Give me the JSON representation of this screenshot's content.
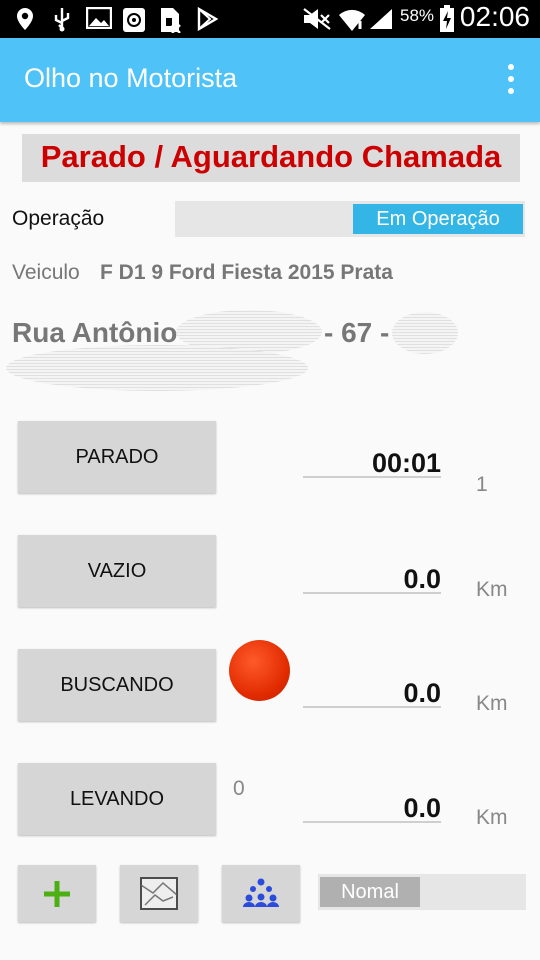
{
  "status_bar": {
    "battery_percent": "58%",
    "time": "02:06",
    "icons": [
      "location-pin-icon",
      "usb-icon",
      "image-icon",
      "accessibility-icon",
      "sim-card-icon",
      "play-store-icon",
      "mute-icon",
      "wifi-icon",
      "signal-icon",
      "battery-charging-icon"
    ]
  },
  "action_bar": {
    "title": "Olho no Motorista",
    "menu_icon": "overflow-menu-icon",
    "color": "#4fc3f7"
  },
  "status_banner": {
    "text": "Parado / Aguardando Chamada",
    "color": "#cc0000"
  },
  "operation": {
    "label": "Operação",
    "toggle_label": "Em Operação"
  },
  "vehicle": {
    "label": "Veiculo",
    "value": "F  D1   9 Ford Fiesta 2015 Prata"
  },
  "address": {
    "street": "Rua Antônio",
    "number": "- 67 -"
  },
  "modes": [
    {
      "label": "PARADO",
      "value": "00:01",
      "unit": "1"
    },
    {
      "label": "VAZIO",
      "value": "0.0",
      "unit": "Km"
    },
    {
      "label": "BUSCANDO",
      "value": "0.0",
      "unit": "Km"
    },
    {
      "label": "LEVANDO",
      "value": "0.0",
      "unit": "Km"
    }
  ],
  "counter": "0",
  "record_indicator_color": "#e02a00",
  "toolbar": {
    "add_icon": "add-plus-icon",
    "map_icon": "map-icon",
    "people_icon": "group-people-icon",
    "mode_toggle_label": "Nomal"
  }
}
